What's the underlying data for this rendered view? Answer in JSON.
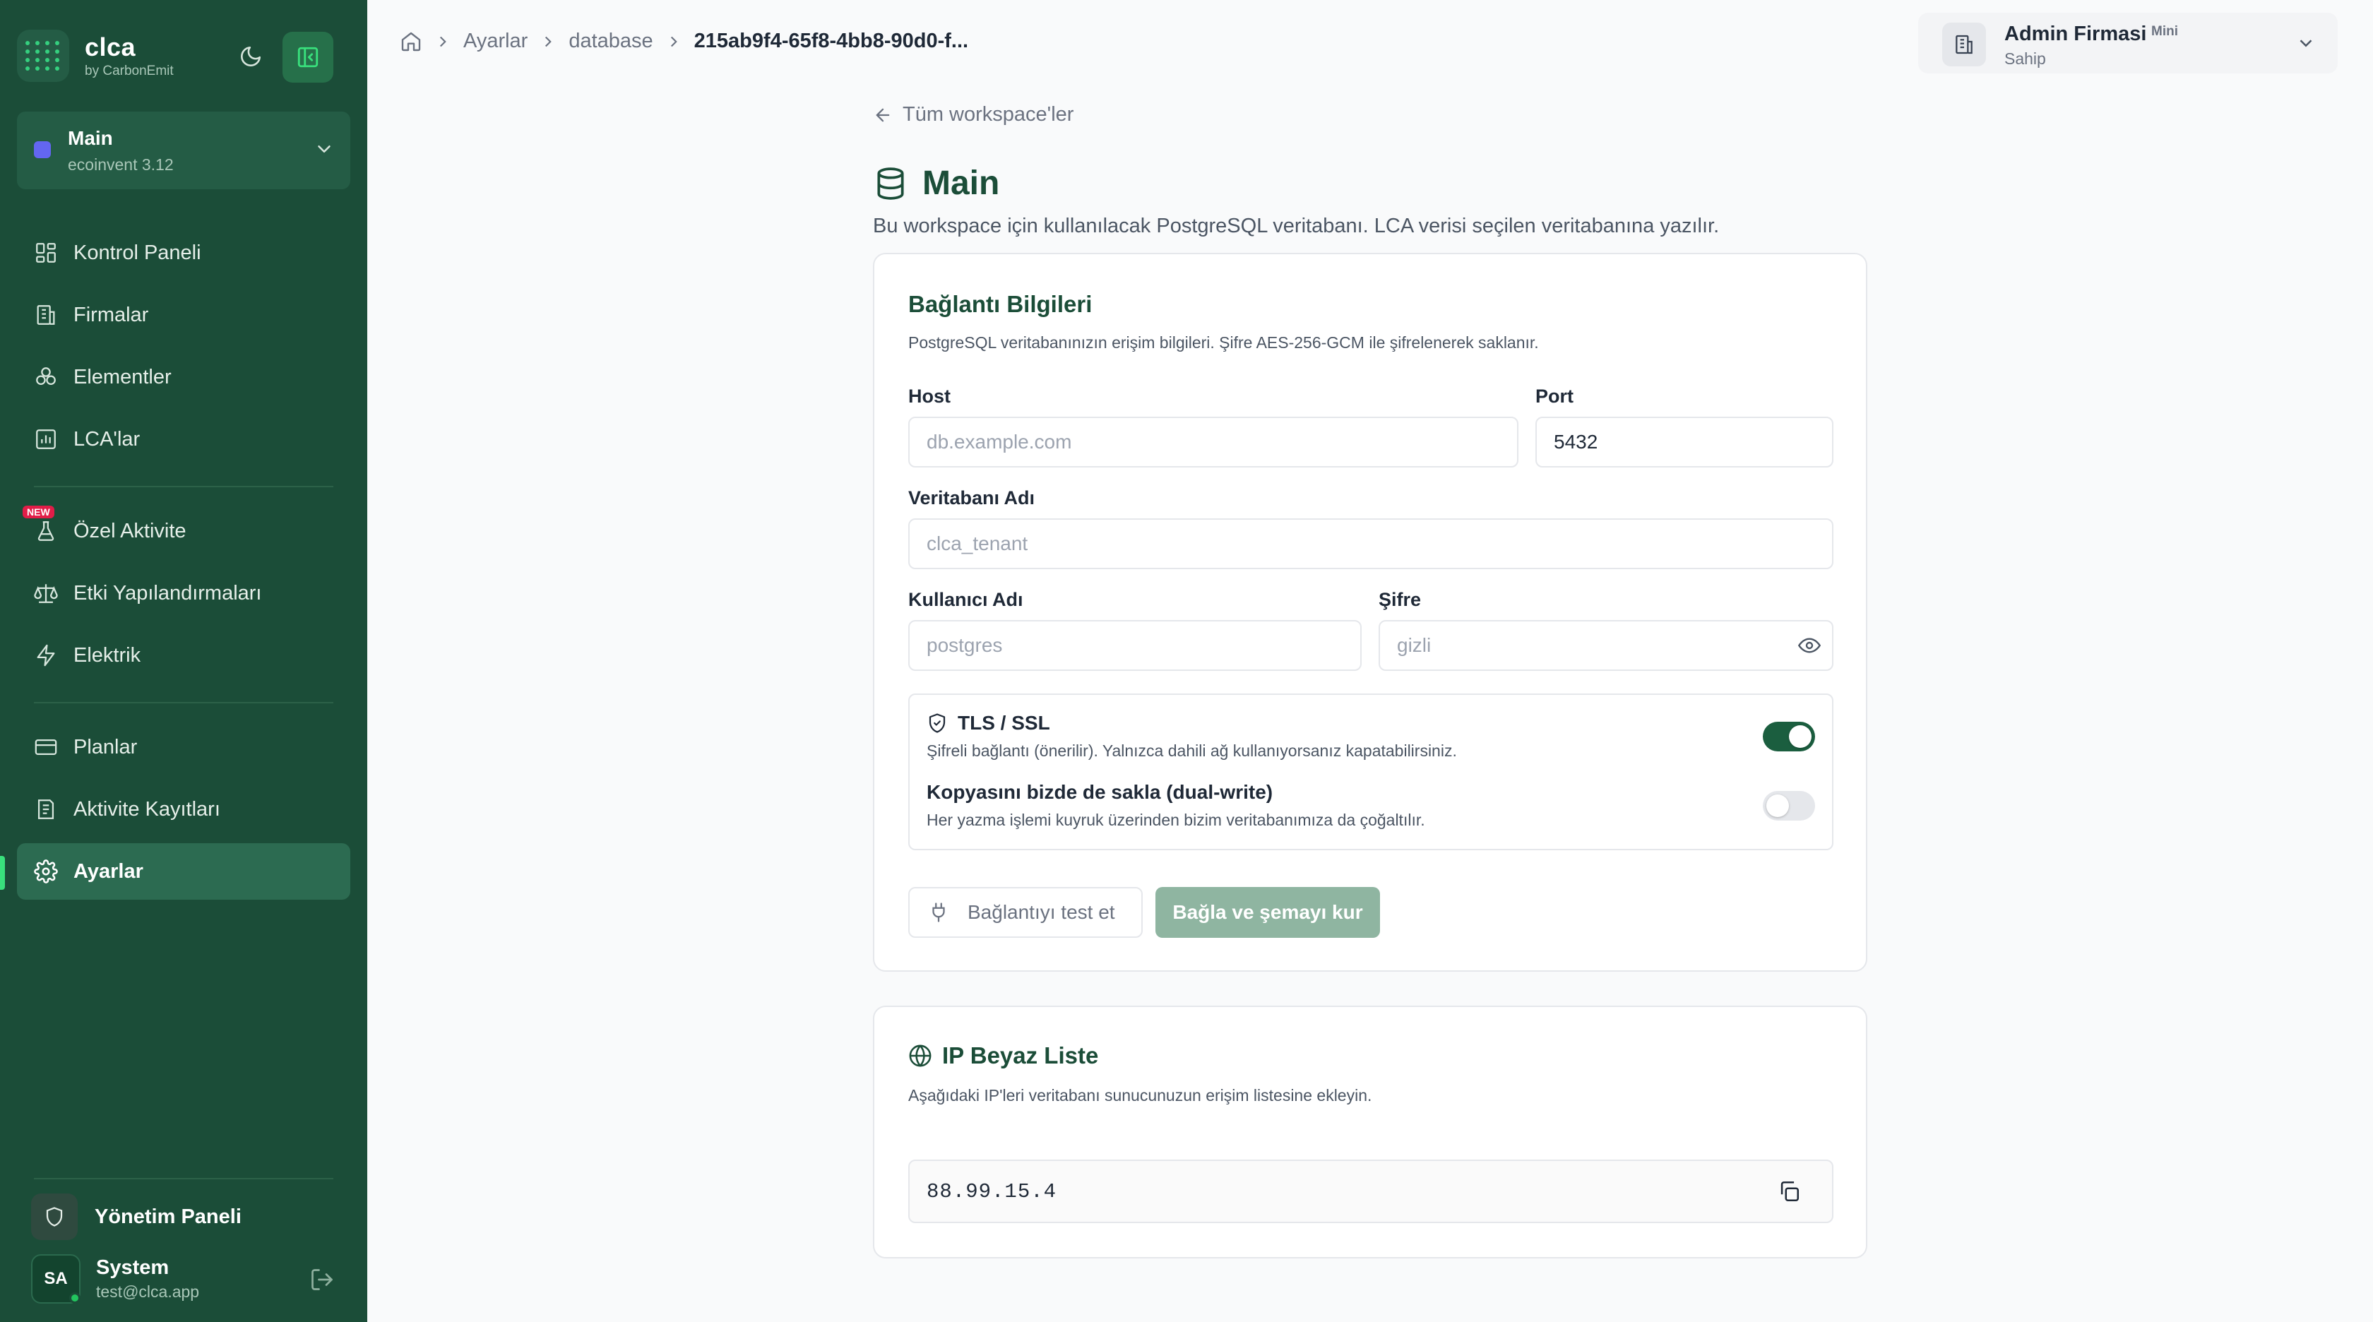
{
  "brand": {
    "name": "clca",
    "sub": "by CarbonEmit"
  },
  "workspace": {
    "name": "Main",
    "db": "ecoinvent 3.12"
  },
  "nav": [
    {
      "label": "Kontrol Paneli",
      "icon": "dashboard-icon"
    },
    {
      "label": "Firmalar",
      "icon": "building-icon"
    },
    {
      "label": "Elementler",
      "icon": "elements-icon"
    },
    {
      "label": "LCA'lar",
      "icon": "chart-icon"
    },
    {
      "label": "Özel Aktivite",
      "icon": "flask-icon",
      "badge": "NEW"
    },
    {
      "label": "Etki Yapılandırmaları",
      "icon": "scale-icon"
    },
    {
      "label": "Elektrik",
      "icon": "lightning-icon"
    },
    {
      "label": "Planlar",
      "icon": "card-icon"
    },
    {
      "label": "Aktivite Kayıtları",
      "icon": "log-icon"
    },
    {
      "label": "Ayarlar",
      "icon": "gear-icon",
      "active": true
    }
  ],
  "footer": {
    "admin_label": "Yönetim Paneli",
    "user_initials": "SA",
    "user_name": "System",
    "user_email": "test@clca.app"
  },
  "breadcrumb": {
    "item1": "Ayarlar",
    "item2": "database",
    "current": "215ab9f4-65f8-4bb8-90d0-f..."
  },
  "org": {
    "name": "Admin Firmasi",
    "plan": "Mini",
    "role": "Sahip"
  },
  "page": {
    "back_label": "Tüm workspace'ler",
    "title": "Main",
    "description": "Bu workspace için kullanılacak PostgreSQL veritabanı. LCA verisi seçilen veritabanına yazılır."
  },
  "connection": {
    "title": "Bağlantı Bilgileri",
    "subtitle": "PostgreSQL veritabanınızın erişim bilgileri. Şifre AES-256-GCM ile şifrelenerek saklanır.",
    "host_label": "Host",
    "host_placeholder": "db.example.com",
    "port_label": "Port",
    "port_value": "5432",
    "dbname_label": "Veritabanı Adı",
    "dbname_placeholder": "clca_tenant",
    "user_label": "Kullanıcı Adı",
    "user_placeholder": "postgres",
    "password_label": "Şifre",
    "password_placeholder": "gizli",
    "tls_title": "TLS / SSL",
    "tls_desc": "Şifreli bağlantı (önerilir). Yalnızca dahili ağ kullanıyorsanız kapatabilirsiniz.",
    "tls_enabled": true,
    "dual_title": "Kopyasını bizde de sakla (dual-write)",
    "dual_desc": "Her yazma işlemi kuyruk üzerinden bizim veritabanımıza da çoğaltılır.",
    "dual_enabled": false,
    "test_button": "Bağlantıyı test et",
    "connect_button": "Bağla ve şemayı kur"
  },
  "whitelist": {
    "title": "IP Beyaz Liste",
    "subtitle": "Aşağıdaki IP'leri veritabanı sunucunuzun erişim listesine ekleyin.",
    "ip": "88.99.15.4"
  },
  "colors": {
    "sidebar": "#1b4d38",
    "accent": "#39e07c",
    "primary": "#1b5e3f",
    "disabled_primary": "#8fb5a1"
  }
}
